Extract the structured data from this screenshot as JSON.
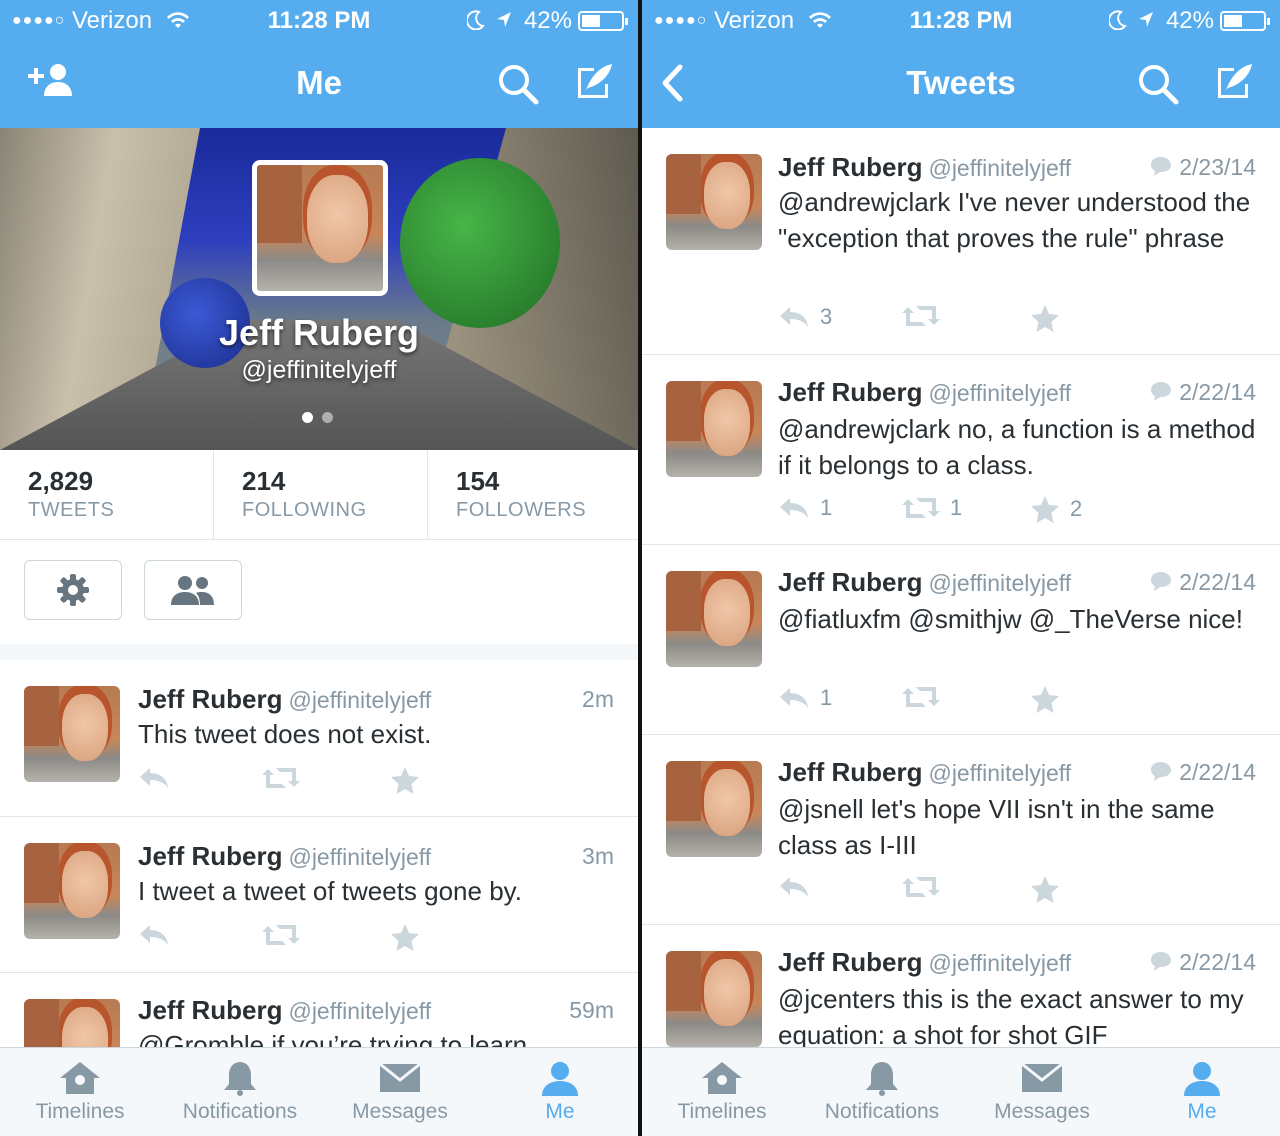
{
  "colors": {
    "brand": "#55acee",
    "text": "#292f33",
    "muted": "#8899a6",
    "border": "#e1e8ed"
  },
  "status_bar": {
    "carrier": "Verizon",
    "time": "11:28 PM",
    "battery": "42%"
  },
  "left": {
    "nav_title": "Me",
    "profile": {
      "name": "Jeff Ruberg",
      "handle": "@jeffinitelyjeff"
    },
    "stats": [
      {
        "number": "2,829",
        "label": "TWEETS"
      },
      {
        "number": "214",
        "label": "FOLLOWING"
      },
      {
        "number": "154",
        "label": "FOLLOWERS"
      }
    ],
    "tweets": [
      {
        "name": "Jeff Ruberg",
        "handle": "@jeffinitelyjeff",
        "time": "2m",
        "text": "This tweet does not exist.",
        "replies": "",
        "retweets": "",
        "favorites": ""
      },
      {
        "name": "Jeff Ruberg",
        "handle": "@jeffinitelyjeff",
        "time": "3m",
        "text": "I tweet a tweet of tweets gone by.",
        "replies": "",
        "retweets": "",
        "favorites": ""
      },
      {
        "name": "Jeff Ruberg",
        "handle": "@jeffinitelyjeff",
        "time": "59m",
        "text": "@Gromble if you’re trying to learn",
        "replies": "",
        "retweets": "",
        "favorites": ""
      }
    ]
  },
  "right": {
    "nav_title": "Tweets",
    "tweets": [
      {
        "name": "Jeff Ruberg",
        "handle": "@jeffinitelyjeff",
        "time": "2/23/14",
        "text": "@andrewjclark I've never understood the \"exception that proves the rule\" phrase",
        "replies": "3",
        "retweets": "",
        "favorites": ""
      },
      {
        "name": "Jeff Ruberg",
        "handle": "@jeffinitelyjeff",
        "time": "2/22/14",
        "text": "@andrewjclark no, a function is a method if it belongs to a class.",
        "replies": "1",
        "retweets": "1",
        "favorites": "2"
      },
      {
        "name": "Jeff Ruberg",
        "handle": "@jeffinitelyjeff",
        "time": "2/22/14",
        "text": "@fiatluxfm @smithjw @_TheVerse nice!",
        "replies": "1",
        "retweets": "",
        "favorites": ""
      },
      {
        "name": "Jeff Ruberg",
        "handle": "@jeffinitelyjeff",
        "time": "2/22/14",
        "text": "@jsnell let's hope VII isn't in the same class as I-III",
        "replies": "",
        "retweets": "",
        "favorites": ""
      },
      {
        "name": "Jeff Ruberg",
        "handle": "@jeffinitelyjeff",
        "time": "2/22/14",
        "text": "@jcenters this is the exact answer to my equation: a shot for shot GIF",
        "replies": "",
        "retweets": "",
        "favorites": ""
      }
    ]
  },
  "tabs": [
    {
      "label": "Timelines",
      "icon": "home-icon"
    },
    {
      "label": "Notifications",
      "icon": "bell-icon"
    },
    {
      "label": "Messages",
      "icon": "envelope-icon"
    },
    {
      "label": "Me",
      "icon": "person-icon",
      "active": true
    }
  ]
}
